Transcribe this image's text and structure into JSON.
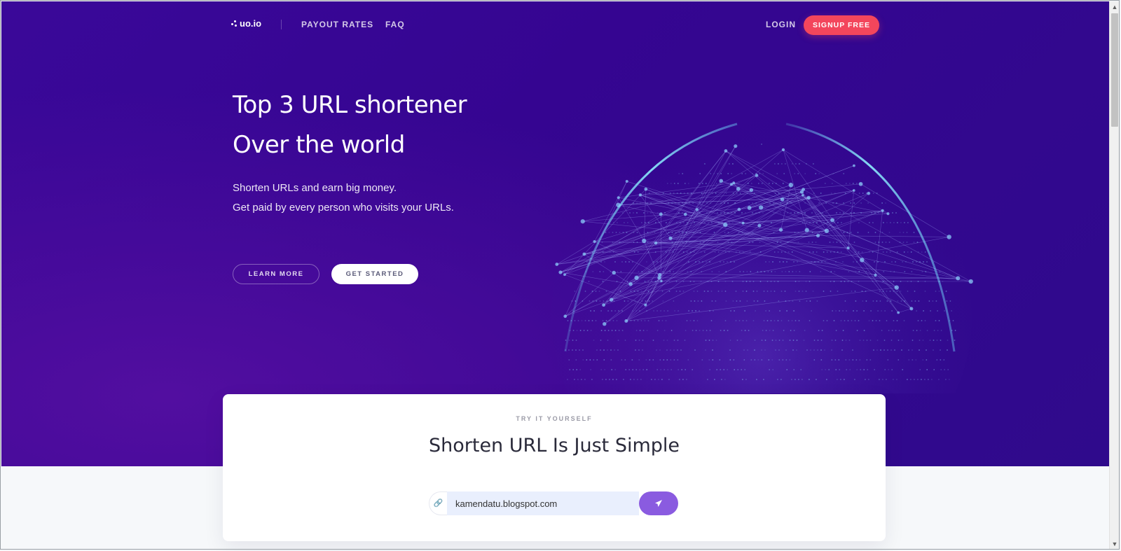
{
  "brand": {
    "logo_text": "uo.io"
  },
  "nav": {
    "links": [
      "PAYOUT RATES",
      "FAQ"
    ],
    "login_label": "LOGIN",
    "signup_label": "SIGNUP FREE"
  },
  "hero": {
    "title_line1": "Top 3 URL shortener",
    "title_line2": "Over the world",
    "subtitle_line1": "Shorten URLs and earn big money.",
    "subtitle_line2": "Get paid by every person who visits your URLs.",
    "learn_more_label": "LEARN MORE",
    "get_started_label": "GET STARTED"
  },
  "shortener": {
    "eyebrow": "TRY IT YOURSELF",
    "title": "Shorten URL Is Just Simple",
    "input_value": "kamendatu.blogspot.com",
    "prefix_icon": "link-icon",
    "submit_icon": "paper-plane-icon"
  },
  "colors": {
    "hero_bg": "#350591",
    "signup_bg": "#f3465c",
    "submit_bg": "#8a5be0",
    "input_bg": "#e9effd"
  }
}
